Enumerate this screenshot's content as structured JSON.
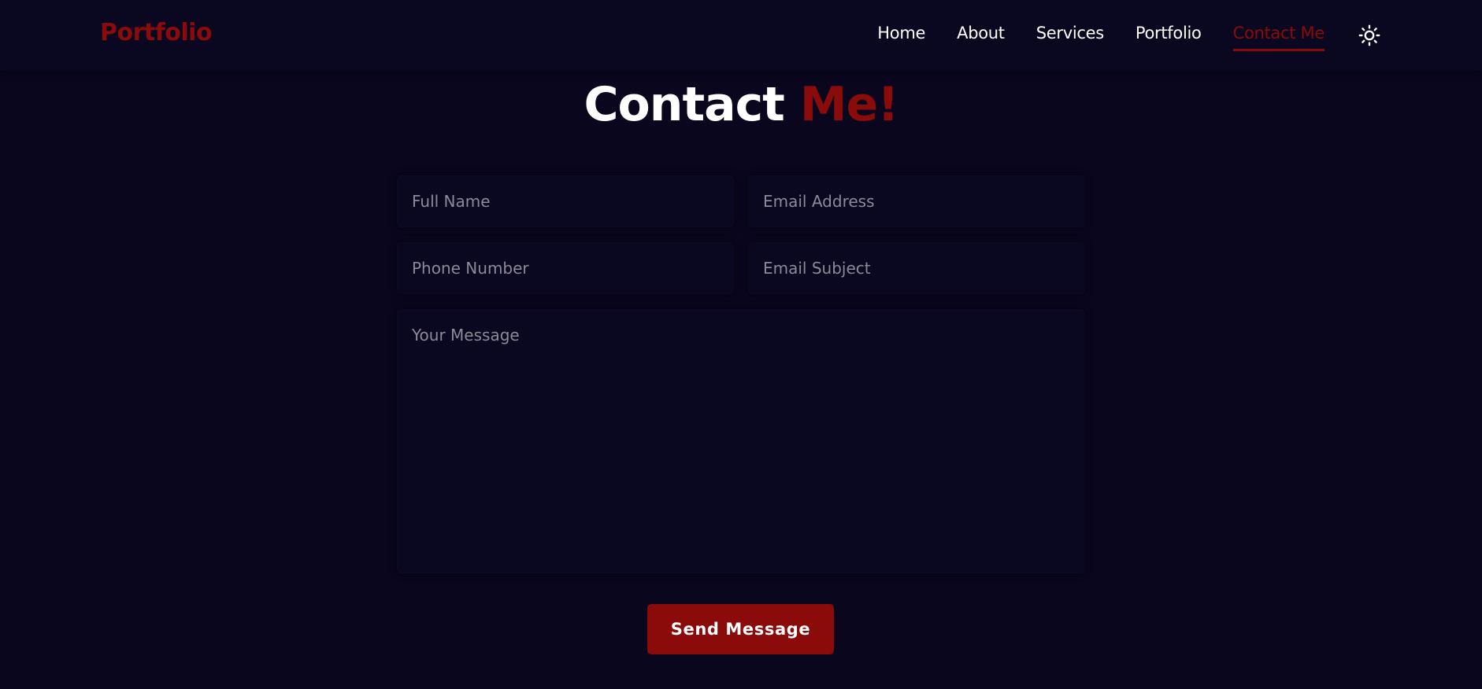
{
  "nav": {
    "logo": "Portfolio",
    "links": [
      {
        "label": "Home"
      },
      {
        "label": "About"
      },
      {
        "label": "Services"
      },
      {
        "label": "Portfolio"
      },
      {
        "label": "Contact Me",
        "active": true
      }
    ],
    "theme_icon": "sun-icon"
  },
  "heading": {
    "part1": "Contact",
    "part2": "Me!"
  },
  "form": {
    "full_name": {
      "placeholder": "Full Name",
      "value": ""
    },
    "email_address": {
      "placeholder": "Email Address",
      "value": ""
    },
    "phone_number": {
      "placeholder": "Phone Number",
      "value": ""
    },
    "email_subject": {
      "placeholder": "Email Subject",
      "value": ""
    },
    "message": {
      "placeholder": "Your Message",
      "value": ""
    },
    "submit_label": "Send Message"
  },
  "colors": {
    "background": "#09061e",
    "accent": "#8b0a0a",
    "text": "#ffffff",
    "placeholder": "#8c8a97"
  }
}
